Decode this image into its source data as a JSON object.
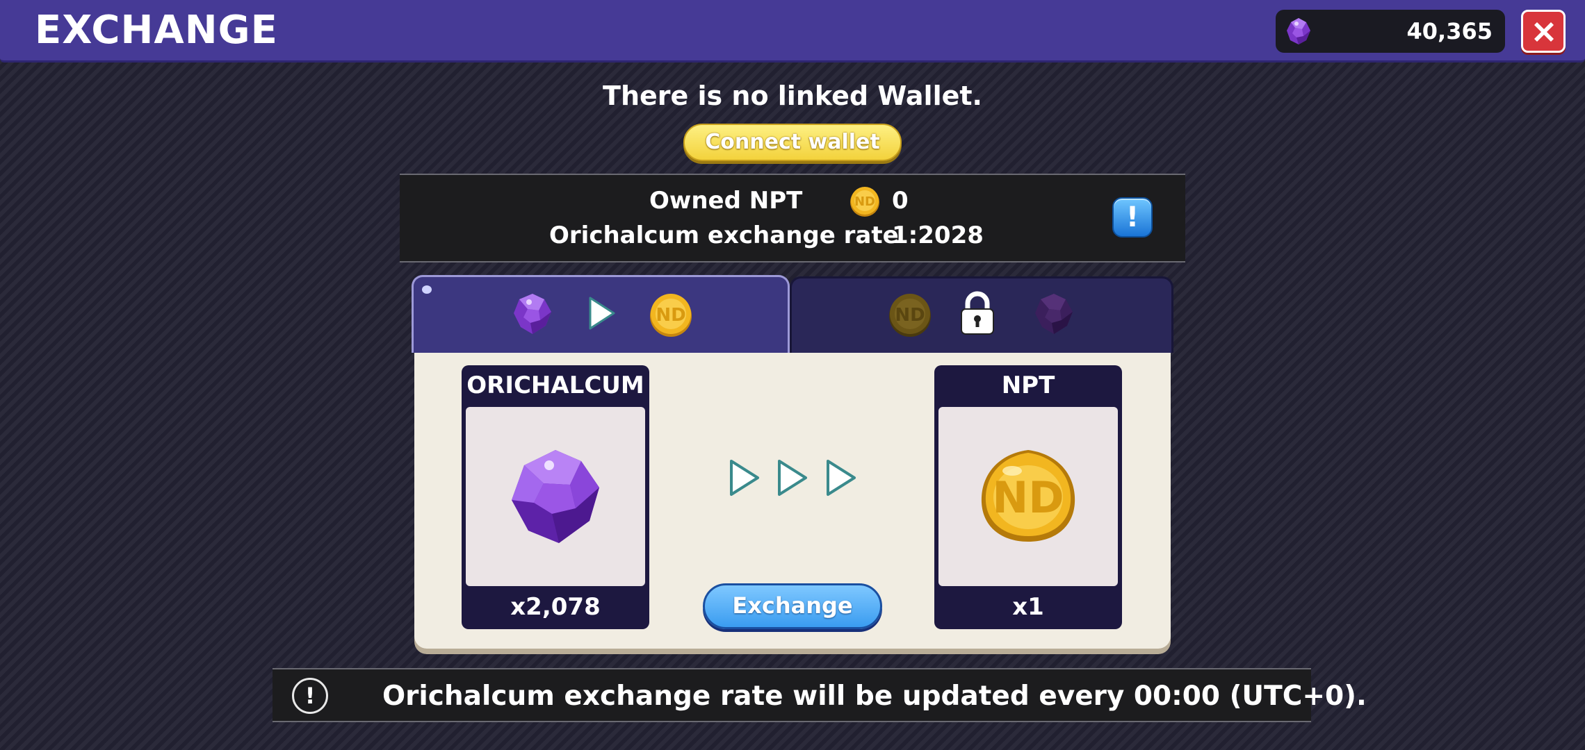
{
  "header": {
    "title": "EXCHANGE",
    "currency_icon": "orichalcum-gem-icon",
    "currency_value": "40,365",
    "close_icon": "close-icon"
  },
  "wallet": {
    "notice": "There is no linked Wallet.",
    "connect_label": "Connect wallet"
  },
  "info": {
    "owned_label": "Owned NPT",
    "owned_icon": "npt-coin-icon",
    "owned_value": "0",
    "rate_label": "Orichalcum exchange rate",
    "rate_value": "1:2028",
    "info_button_icon": "info-icon"
  },
  "tabs": [
    {
      "name": "orichalcum-to-npt",
      "active": true,
      "icons": [
        "orichalcum-gem-icon",
        "play-arrow-icon",
        "npt-coin-icon"
      ]
    },
    {
      "name": "npt-to-orichalcum",
      "active": false,
      "locked": true,
      "icons": [
        "npt-coin-icon",
        "lock-icon",
        "orichalcum-gem-icon"
      ]
    }
  ],
  "exchange": {
    "from": {
      "title": "ORICHALCUM",
      "quantity": "x2,078",
      "icon": "orichalcum-gem-icon"
    },
    "to": {
      "title": "NPT",
      "quantity": "x1",
      "icon": "npt-coin-icon"
    },
    "button_label": "Exchange"
  },
  "footer": {
    "notice": "Orichalcum exchange rate will be updated every 00:00 (UTC+0)."
  },
  "colors": {
    "header_bg": "#463a96",
    "connect_button": "#f3d23c",
    "exchange_button": "#3a9cf0",
    "close_button": "#d8353b",
    "gem_purple": "#8a3fd6",
    "coin_gold": "#f0b11c"
  }
}
